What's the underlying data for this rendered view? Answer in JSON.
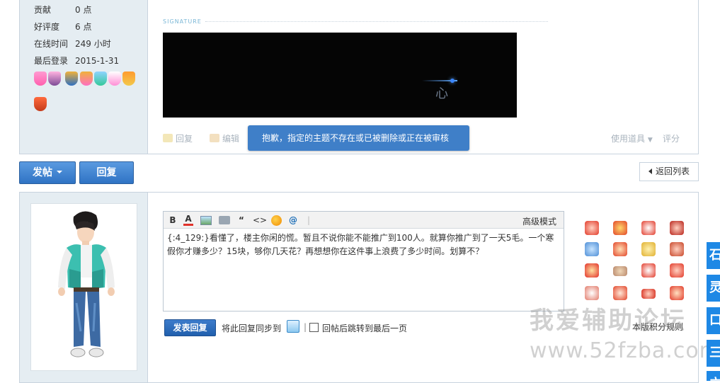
{
  "profile_stats": [
    {
      "label": "贡献",
      "value": "0 点"
    },
    {
      "label": "好评度",
      "value": "6 点"
    },
    {
      "label": "在线时间",
      "value": "249 小时"
    },
    {
      "label": "最后登录",
      "value": "2015-1-31"
    }
  ],
  "signature": {
    "label": "SIGNATURE",
    "image_glyph": "心"
  },
  "post_actions": {
    "reply": "回复",
    "edit": "编辑",
    "use_item": "使用道具",
    "rate": "评分"
  },
  "toast": {
    "message": "抱歉，指定的主题不存在或已被删除或正在被审核"
  },
  "buttons": {
    "post": "发帖",
    "reply": "回复",
    "back_to_list": "返回列表"
  },
  "editor": {
    "toolbar": {
      "bold": "B",
      "color": "A",
      "image": "",
      "attach": "",
      "quote": "“",
      "code": "<>",
      "emoji": "",
      "mention": "@",
      "separator": "|",
      "advanced_mode": "高级模式"
    },
    "content": "{:4_129:}看懂了，楼主你闲的慌。暂且不说你能不能推广到100人。就算你推广到了一天5毛。一个寒假你才赚多少？15块，够你几天花？再想想你在这件事上浪费了多少时间。划算不？"
  },
  "reply_bar": {
    "submit": "发表回复",
    "sync_label": "将此回复同步到",
    "separator": "|",
    "jump_label": "回帖后跳转到最后一页",
    "rules_link": "本版积分规则"
  },
  "watermark": {
    "line1": "我爱辅助论坛",
    "line2": "www.52fzba.com"
  },
  "side_tabs": [
    "石",
    "灵",
    "口",
    "三",
    "立"
  ],
  "colors": {
    "accent_blue": "#2f73c4",
    "panel_bg": "#e5edf2",
    "toast_bg": "#3f7fc8",
    "side_tab": "#1e88e5"
  }
}
